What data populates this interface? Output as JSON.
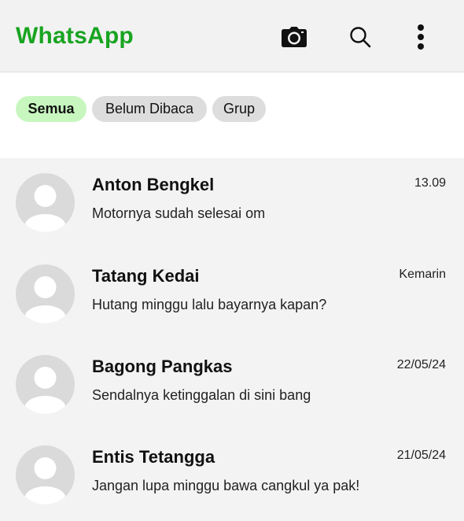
{
  "header": {
    "title": "WhatsApp",
    "title_color": "#19a421",
    "icons": [
      "camera-icon",
      "search-icon",
      "more-vertical-icon"
    ]
  },
  "filters": {
    "chips": [
      {
        "label": "Semua",
        "active": true
      },
      {
        "label": "Belum Dibaca",
        "active": false
      },
      {
        "label": "Grup",
        "active": false
      }
    ],
    "active_color": "#c7f7bf",
    "inactive_color": "#dddddd"
  },
  "chats": [
    {
      "name": "Anton Bengkel",
      "time": "13.09",
      "message": "Motornya sudah selesai om"
    },
    {
      "name": "Tatang Kedai",
      "time": "Kemarin",
      "message": "Hutang minggu lalu bayarnya kapan?"
    },
    {
      "name": "Bagong Pangkas",
      "time": "22/05/24",
      "message": "Sendalnya ketinggalan di sini bang"
    },
    {
      "name": "Entis Tetangga",
      "time": "21/05/24",
      "message": "Jangan lupa minggu bawa cangkul ya pak!"
    }
  ]
}
